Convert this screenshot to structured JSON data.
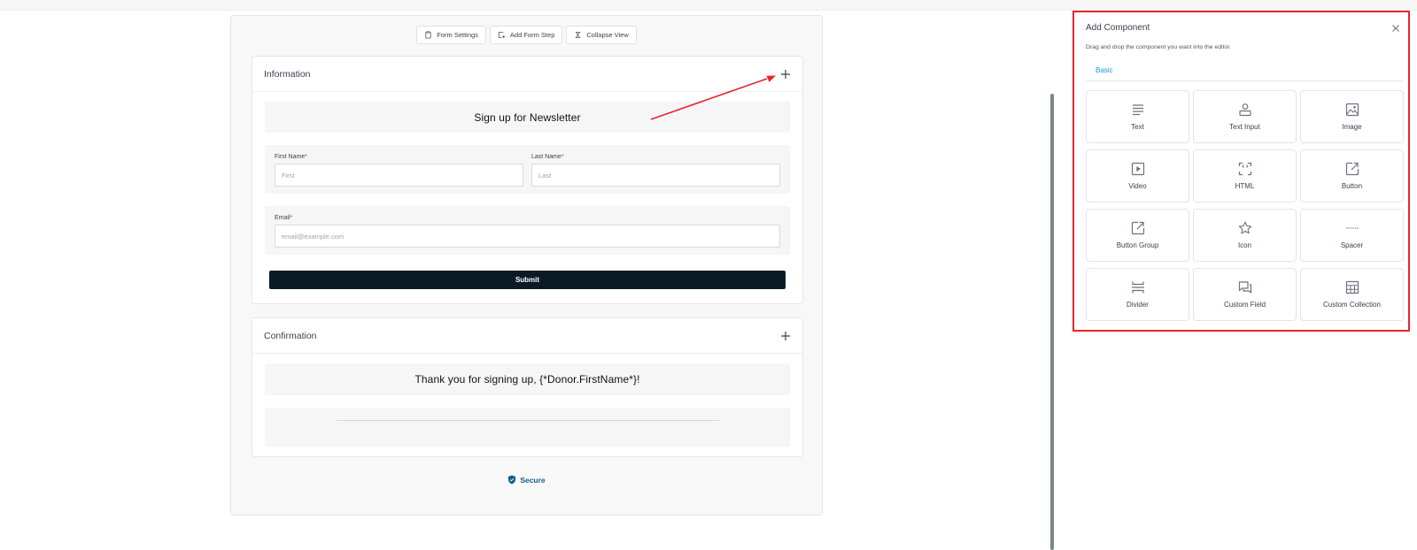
{
  "toolbar": {
    "form_settings": "Form Settings",
    "add_form_step": "Add Form Step",
    "collapse_view": "Collapse View"
  },
  "information": {
    "title": "Information",
    "banner": "Sign up for Newsletter",
    "first_name_label": "First Name",
    "first_name_placeholder": "First",
    "last_name_label": "Last Name",
    "last_name_placeholder": "Last",
    "email_label": "Email",
    "email_placeholder": "email@example.com",
    "required_mark": "*",
    "submit": "Submit"
  },
  "confirmation": {
    "title": "Confirmation",
    "message": "Thank you for signing up, {*Donor.FirstName*}!"
  },
  "secure": {
    "label": "Secure"
  },
  "panel": {
    "title": "Add Component",
    "description": "Drag and drop the component you want into the editor.",
    "tab": "Basic",
    "components": [
      {
        "label": "Text",
        "icon": "text-icon"
      },
      {
        "label": "Text Input",
        "icon": "text-input-icon"
      },
      {
        "label": "Image",
        "icon": "image-icon"
      },
      {
        "label": "Video",
        "icon": "video-icon"
      },
      {
        "label": "HTML",
        "icon": "html-icon"
      },
      {
        "label": "Button",
        "icon": "button-icon"
      },
      {
        "label": "Button Group",
        "icon": "button-group-icon"
      },
      {
        "label": "Icon",
        "icon": "star-icon"
      },
      {
        "label": "Spacer",
        "icon": "spacer-icon"
      },
      {
        "label": "Divider",
        "icon": "divider-icon"
      },
      {
        "label": "Custom Field",
        "icon": "custom-field-icon"
      },
      {
        "label": "Custom Collection",
        "icon": "table-icon"
      }
    ]
  },
  "colors": {
    "accent": "#1497d4",
    "highlight": "#e5262b",
    "submit_bg": "#0b1b26",
    "secure": "#0f5f8a"
  }
}
